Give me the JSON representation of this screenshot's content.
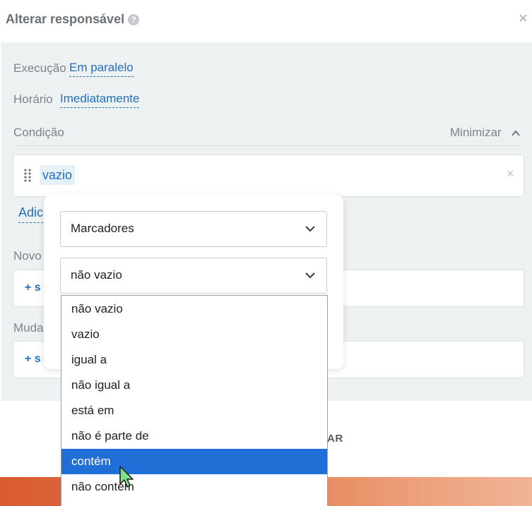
{
  "header": {
    "title": "Alterar responsável",
    "help_icon": "?",
    "close_icon": "×"
  },
  "form": {
    "execucao_label": "Execução",
    "execucao_value": "Em paralelo",
    "horario_label": "Horário",
    "horario_value": "Imediatamente",
    "condicao_label": "Condição",
    "minimize_label": "Minimizar",
    "condition_tag": "vazio",
    "condition_close": "×",
    "add_condition_partial": "Adic",
    "novo_label_partial": "Novo",
    "add_novo_partial": "+ s",
    "muda_label_partial": "Muda",
    "add_muda_partial": "+ s",
    "footer_button_partial": "AR"
  },
  "popover": {
    "field_select": "Marcadores",
    "operator_select": "não vazio"
  },
  "dropdown": {
    "options": [
      "não vazio",
      "vazio",
      "igual a",
      "não igual a",
      "está em",
      "não é parte de",
      "contém",
      "não contém"
    ],
    "selected_index": 6
  },
  "colors": {
    "accent": "#1f6fbf",
    "selected_bg": "#1f6fd6",
    "panel_bg": "#eef1f2"
  }
}
